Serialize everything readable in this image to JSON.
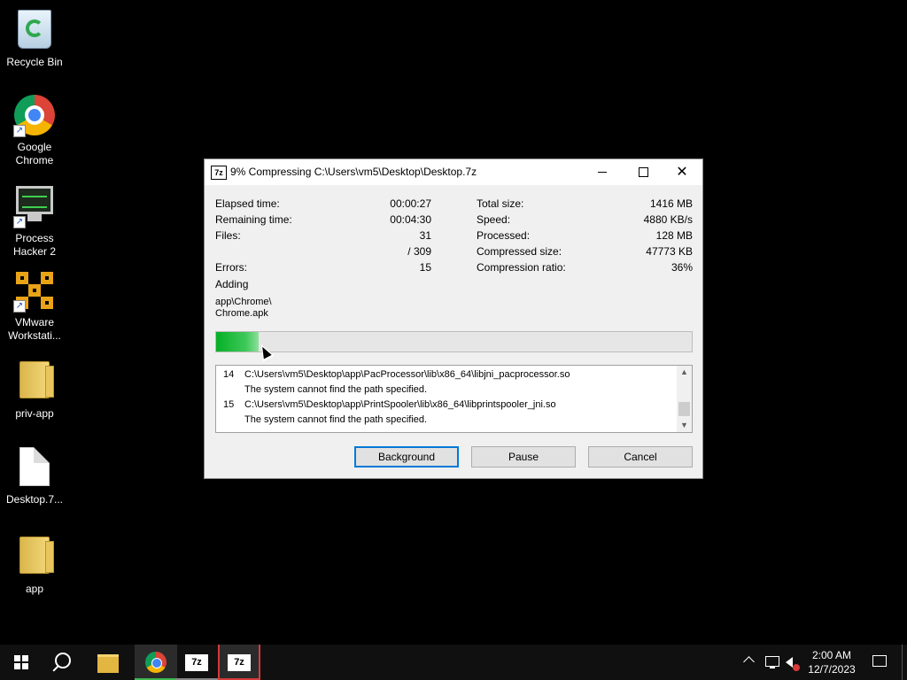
{
  "desktop": {
    "icons": [
      {
        "label": "Recycle Bin",
        "icon": "recycle-bin-icon"
      },
      {
        "label": "Google Chrome",
        "icon": "chrome-icon",
        "shortcut": true
      },
      {
        "label": "Process Hacker 2",
        "icon": "process-hacker-icon",
        "shortcut": true
      },
      {
        "label": "VMware Workstati...",
        "icon": "vmware-icon",
        "shortcut": true
      },
      {
        "label": "priv-app",
        "icon": "folder-icon"
      },
      {
        "label": "Desktop.7...",
        "icon": "file-icon"
      },
      {
        "label": "app",
        "icon": "folder-icon"
      }
    ]
  },
  "dialog": {
    "icon_text": "7z",
    "title": "9% Compressing C:\\Users\\vm5\\Desktop\\Desktop.7z",
    "controls": {
      "minimize": "minimize",
      "maximize": "maximize",
      "close": "✕"
    },
    "left_stats": {
      "elapsed_label": "Elapsed time:",
      "elapsed_value": "00:00:27",
      "remaining_label": "Remaining time:",
      "remaining_value": "00:04:30",
      "files_label": "Files:",
      "files_value": "31",
      "files_total": "/ 309",
      "errors_label": "Errors:",
      "errors_value": "15"
    },
    "right_stats": {
      "total_label": "Total size:",
      "total_value": "1416 MB",
      "speed_label": "Speed:",
      "speed_value": "4880 KB/s",
      "processed_label": "Processed:",
      "processed_value": "128 MB",
      "compressed_label": "Compressed size:",
      "compressed_value": "47773 KB",
      "ratio_label": "Compression ratio:",
      "ratio_value": "36%"
    },
    "adding_label": "Adding",
    "current_file_line1": "app\\Chrome\\",
    "current_file_line2": "Chrome.apk",
    "progress_percent": 9,
    "log": [
      {
        "num": "14",
        "path": "C:\\Users\\vm5\\Desktop\\app\\PacProcessor\\lib\\x86_64\\libjni_pacprocessor.so"
      },
      {
        "num": "",
        "path": "The system cannot find the path specified."
      },
      {
        "num": "15",
        "path": "C:\\Users\\vm5\\Desktop\\app\\PrintSpooler\\lib\\x86_64\\libprintspooler_jni.so"
      },
      {
        "num": "",
        "path": "The system cannot find the path specified."
      }
    ],
    "buttons": {
      "background": "Background",
      "pause": "Pause",
      "cancel": "Cancel"
    }
  },
  "taskbar": {
    "items": [
      "start-icon",
      "search-icon",
      "file-explorer-icon",
      "chrome-icon",
      "7zip-icon",
      "7zip-icon"
    ],
    "seven_zip_label": "7z",
    "clock_time": "2:00 AM",
    "clock_date": "12/7/2023"
  },
  "colors": {
    "progress": "#06b025",
    "focus": "#0078d7",
    "taskbar": "#101010"
  }
}
